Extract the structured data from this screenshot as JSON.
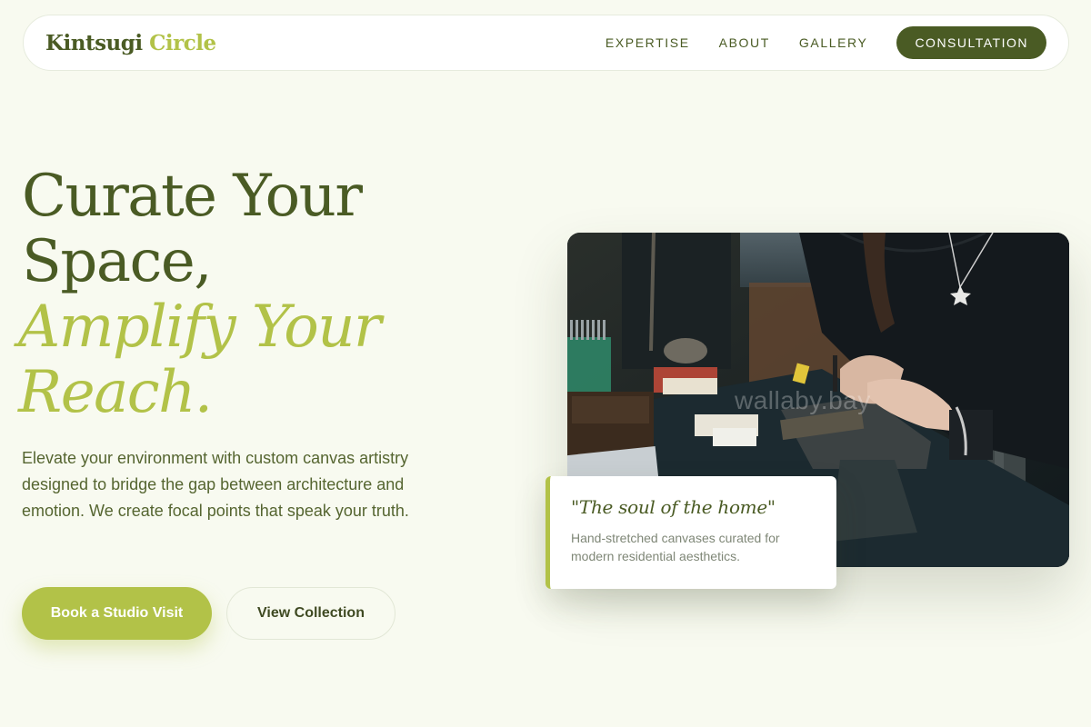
{
  "brand": {
    "part1": "Kintsugi",
    "part2": "Circle"
  },
  "nav": {
    "items": [
      {
        "label": "EXPERTISE"
      },
      {
        "label": "ABOUT"
      },
      {
        "label": "GALLERY"
      }
    ],
    "cta_label": "CONSULTATION"
  },
  "hero": {
    "line1": "Curate Your",
    "line2": "Space,",
    "line3": "Amplify Your",
    "line4": "Reach.",
    "description": "Elevate your environment with custom canvas artistry designed to bridge the gap between architecture and emotion. We create focal points that speak your truth.",
    "primary_button": "Book a Studio Visit",
    "secondary_button": "View Collection"
  },
  "photo": {
    "watermark": "wallaby.bay"
  },
  "quote_card": {
    "title": "\"The soul of the home\"",
    "text": "Hand-stretched canvases curated for modern residential aesthetics."
  },
  "colors": {
    "background": "#f8faf0",
    "primary_dark": "#4a5b24",
    "accent": "#b2c248"
  }
}
